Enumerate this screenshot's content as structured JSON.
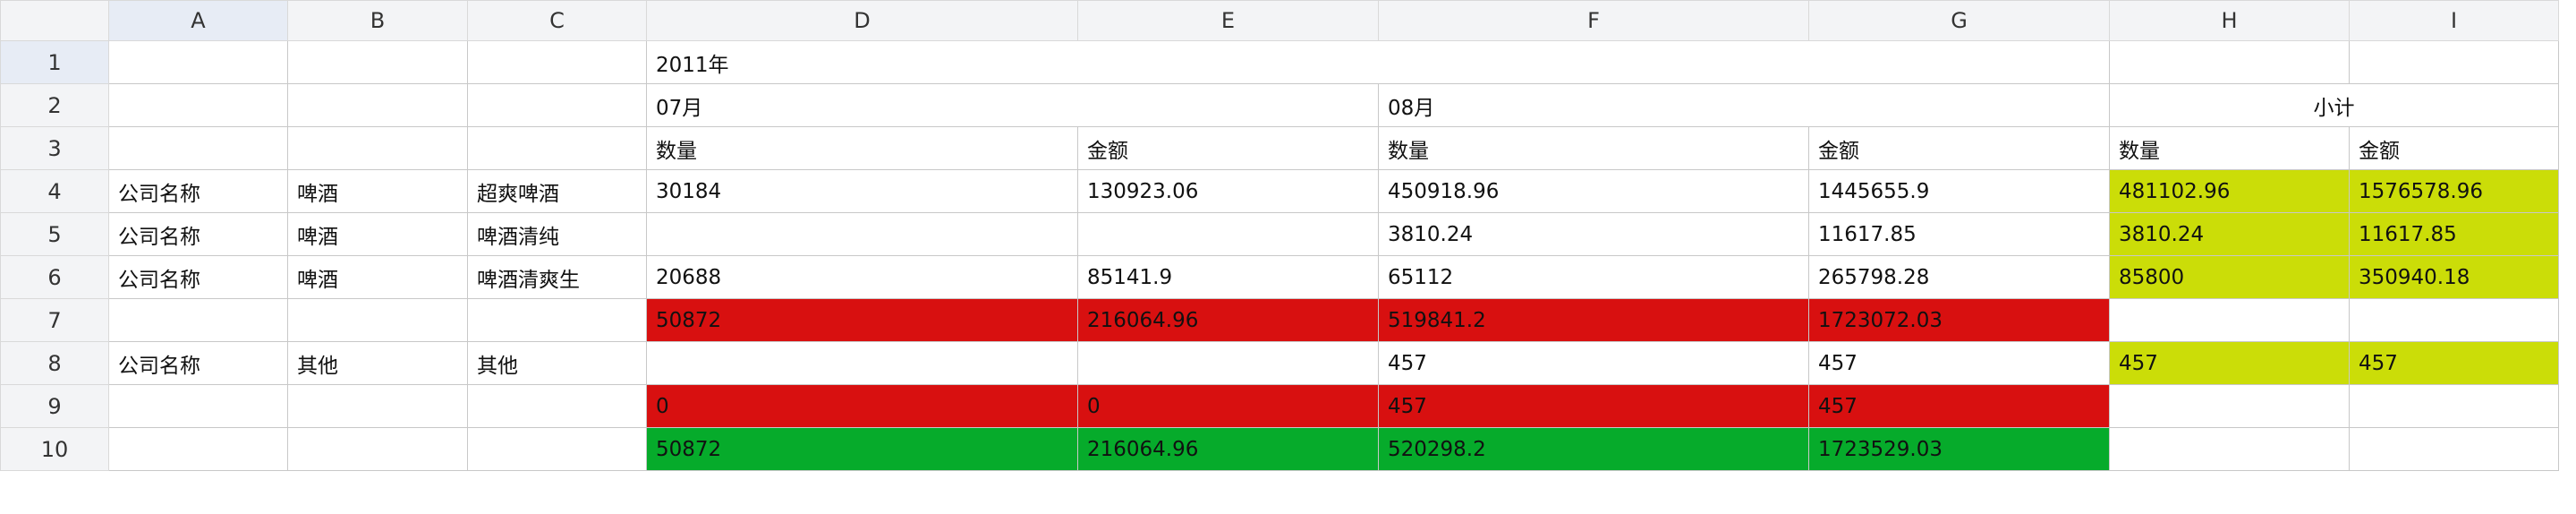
{
  "columns": [
    "A",
    "B",
    "C",
    "D",
    "E",
    "F",
    "G",
    "H",
    "I"
  ],
  "rows": [
    "1",
    "2",
    "3",
    "4",
    "5",
    "6",
    "7",
    "8",
    "9",
    "10"
  ],
  "cells": {
    "year": "2011年",
    "jul": "07月",
    "aug": "08月",
    "subtotal": "小计",
    "qty": "数量",
    "amt": "金额",
    "company": "公司名称",
    "beer": "啤酒",
    "other": "其他",
    "r4": {
      "c": "超爽啤酒",
      "d": "30184",
      "e": "130923.06",
      "f": "450918.96",
      "g": "1445655.9",
      "h": "481102.96",
      "i": "1576578.96"
    },
    "r5": {
      "c": "啤酒清纯",
      "f": "3810.24",
      "g": "11617.85",
      "h": "3810.24",
      "i": "11617.85"
    },
    "r6": {
      "c": "啤酒清爽生",
      "d": "20688",
      "e": "85141.9",
      "f": "65112",
      "g": "265798.28",
      "h": "85800",
      "i": "350940.18"
    },
    "r7": {
      "d": "50872",
      "e": "216064.96",
      "f": "519841.2",
      "g": "1723072.03"
    },
    "r8": {
      "f": "457",
      "g": "457",
      "h": "457",
      "i": "457"
    },
    "r9": {
      "d": "0",
      "e": "0",
      "f": "457",
      "g": "457"
    },
    "r10": {
      "d": "50872",
      "e": "216064.96",
      "f": "520298.2",
      "g": "1723529.03"
    }
  },
  "colors": {
    "red": "#d81010",
    "green": "#06ab2b",
    "yellow": "#cbdd08"
  }
}
